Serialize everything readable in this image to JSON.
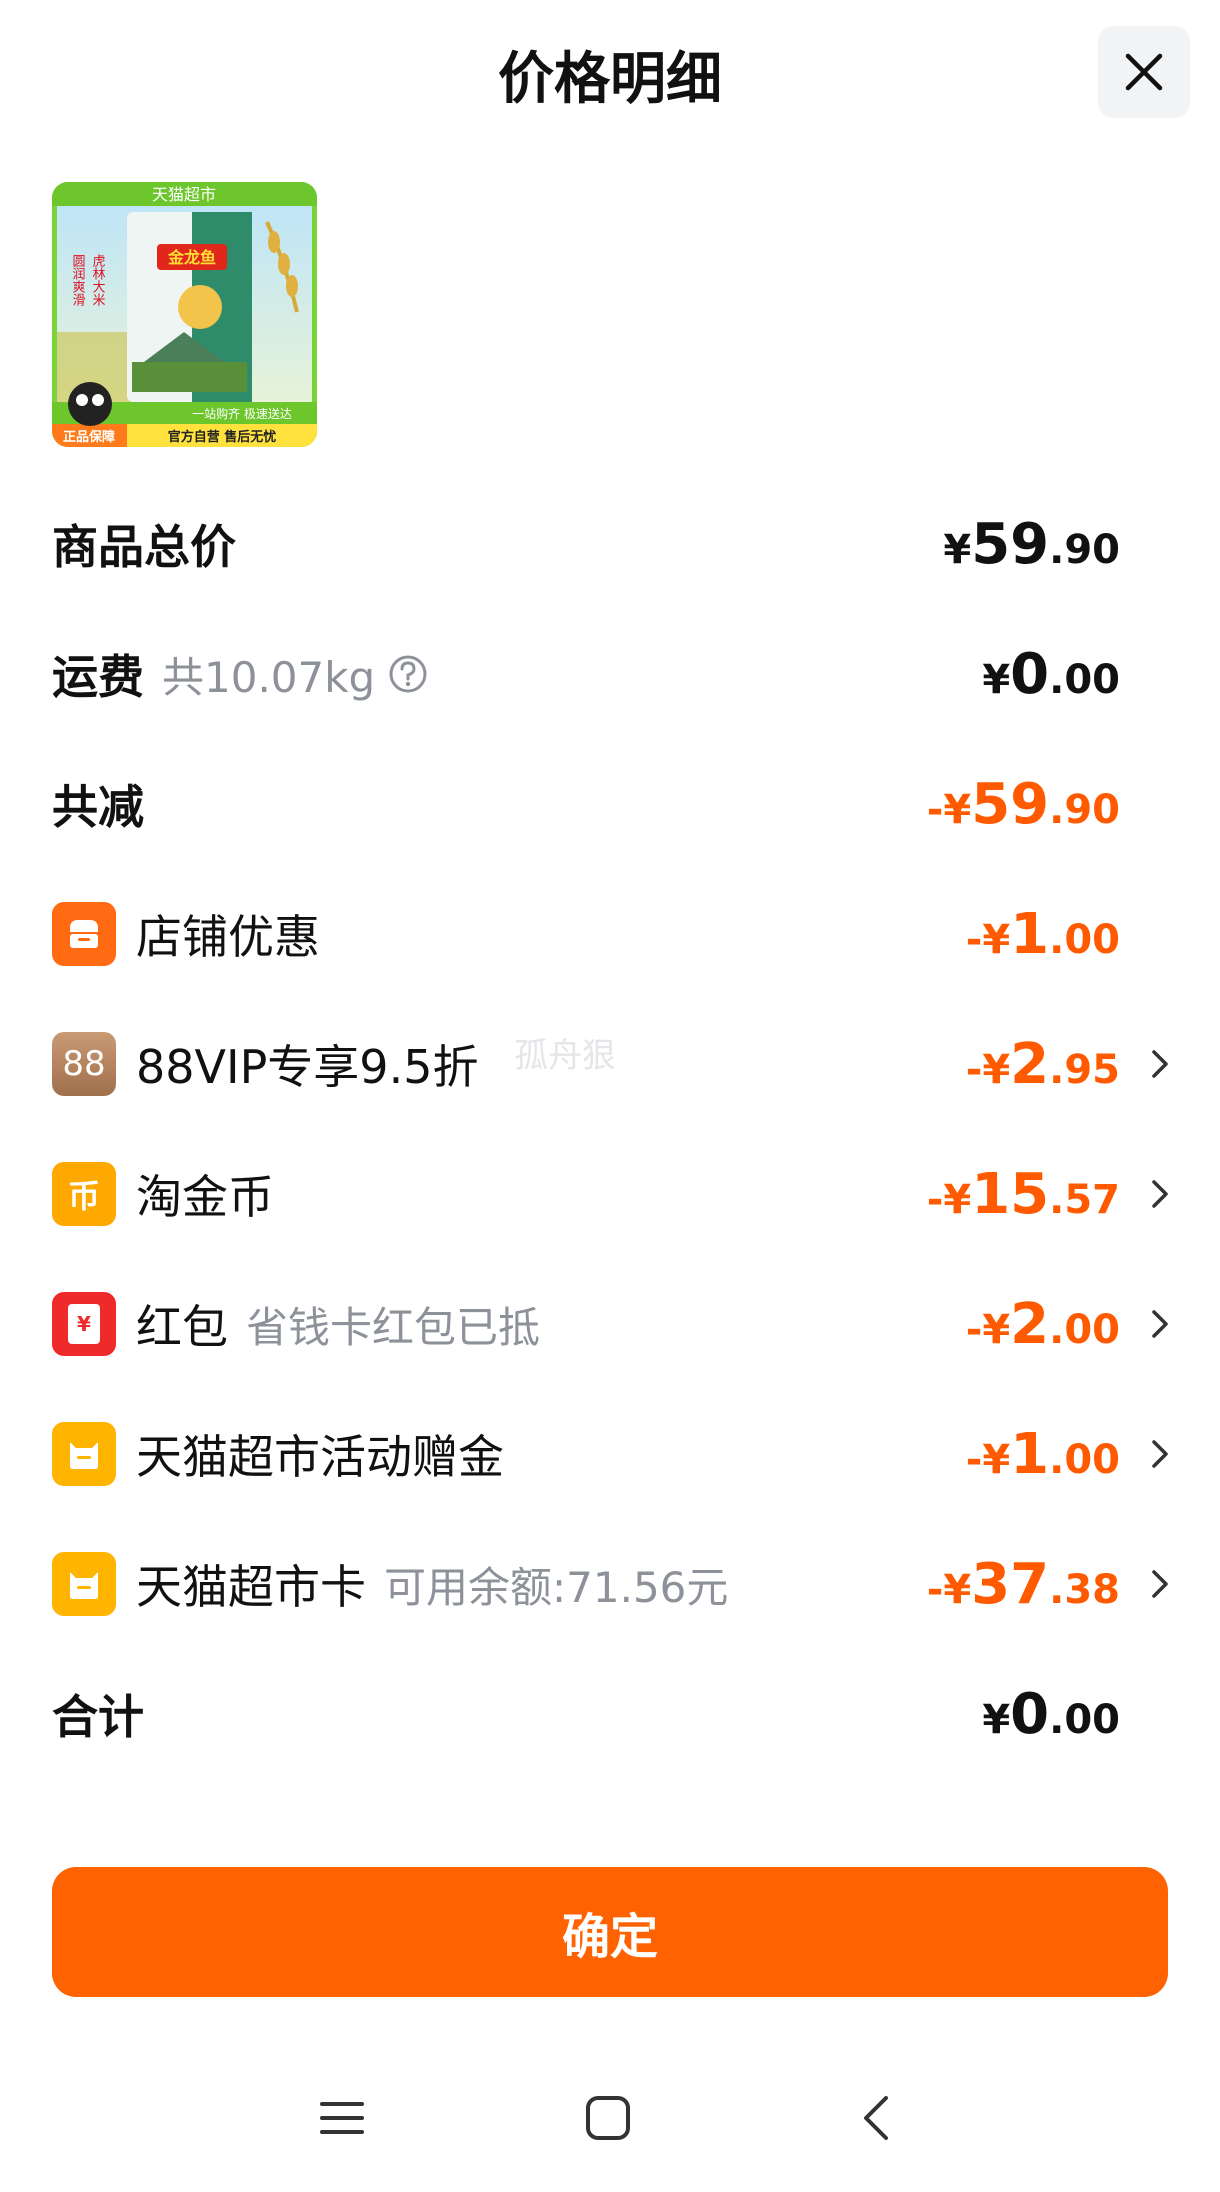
{
  "header": {
    "title": "价格明细"
  },
  "product": {
    "badge_top": "天猫超市",
    "brand": "金龙鱼",
    "side_text": "虎林大米",
    "side_text2": "圆润爽滑",
    "bottom_line1": "一站购齐 极速送达",
    "bottom_tag": "正品保障",
    "bottom_line2": "官方自营 售后无忧"
  },
  "rows": {
    "total_price": {
      "label": "商品总价",
      "amount": {
        "currency": "¥",
        "int": "59",
        "dec": ".90"
      }
    },
    "shipping": {
      "label": "运费",
      "sub": "共10.07kg",
      "amount": {
        "currency": "¥",
        "int": "0",
        "dec": ".00"
      }
    },
    "total_reduce": {
      "label": "共减",
      "amount": {
        "currency": "-¥",
        "int": "59",
        "dec": ".90"
      }
    },
    "discounts": [
      {
        "label": "店铺优惠",
        "sub": "",
        "currency": "-¥",
        "int": "1",
        "dec": ".00",
        "icon": "shop-icon",
        "icon_color": "#ff6a13"
      },
      {
        "label": "88VIP专享9.5折",
        "sub": "",
        "currency": "-¥",
        "int": "2",
        "dec": ".95",
        "icon": "vip88-icon",
        "icon_text": "88",
        "icon_color": "#b4805b"
      },
      {
        "label": "淘金币",
        "sub": "",
        "currency": "-¥",
        "int": "15",
        "dec": ".57",
        "icon": "coin-icon",
        "icon_text": "币",
        "icon_color": "#ffa800"
      },
      {
        "label": "红包",
        "sub": "省钱卡红包已抵",
        "currency": "-¥",
        "int": "2",
        "dec": ".00",
        "icon": "red-packet-icon",
        "icon_text": "¥",
        "icon_color": "#ee2a2a"
      },
      {
        "label": "天猫超市活动赠金",
        "sub": "",
        "currency": "-¥",
        "int": "1",
        "dec": ".00",
        "icon": "tmall-gift-icon",
        "icon_color": "#ffb400"
      },
      {
        "label": "天猫超市卡",
        "sub": "可用余额:71.56元",
        "currency": "-¥",
        "int": "37",
        "dec": ".38",
        "icon": "tmall-card-icon",
        "icon_color": "#ffb400"
      }
    ],
    "sum": {
      "label": "合计",
      "amount": {
        "currency": "¥",
        "int": "0",
        "dec": ".00"
      }
    }
  },
  "watermark": "孤舟狠",
  "confirm_label": "确定",
  "colors": {
    "accent": "#ff6200",
    "discount": "#ff5a00"
  }
}
